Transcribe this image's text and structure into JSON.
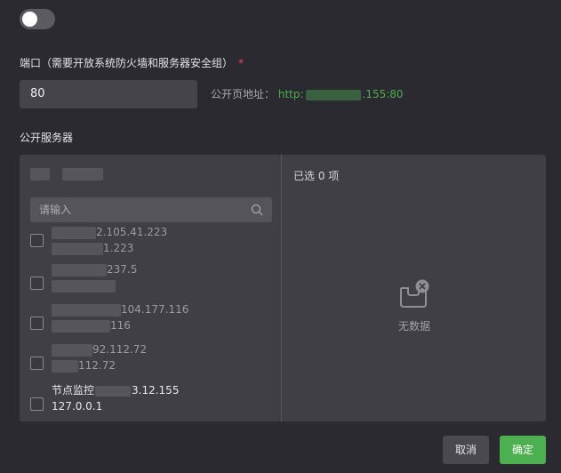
{
  "toggle": {
    "on": false
  },
  "port": {
    "label": "端口（需要开放系统防火墙和服务器安全组）",
    "required_mark": "*",
    "value": "80",
    "public_address_label": "公开页地址：",
    "public_address_prefix": "http:",
    "public_address_suffix": ".155:80"
  },
  "servers": {
    "label": "公开服务器",
    "selected_summary": "已选 0 项",
    "search_placeholder": "请输入",
    "empty_text": "无数据",
    "items": [
      {
        "line1": "2.105.41.223",
        "line2": "1.223"
      },
      {
        "line1": "237.5",
        "line2": ""
      },
      {
        "line1": "104.177.116",
        "line2": "116"
      },
      {
        "line1": "92.112.72",
        "line2": "112.72"
      },
      {
        "line1_prefix": "节点监控",
        "line1": "3.12.155",
        "line2": "127.0.0.1"
      }
    ]
  },
  "footer": {
    "cancel": "取消",
    "confirm": "确定"
  },
  "colors": {
    "accent": "#4caf50",
    "background": "#2b2a30",
    "panel": "#403f45",
    "required": "#e5484d"
  }
}
